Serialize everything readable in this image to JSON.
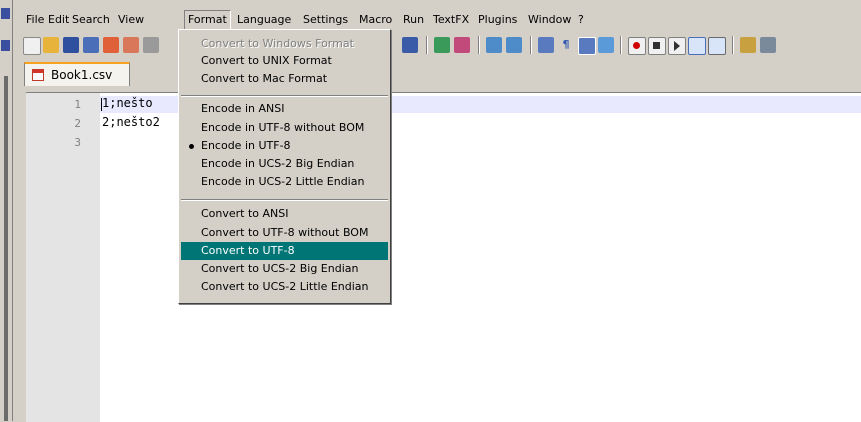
{
  "menubar": {
    "items": [
      "File",
      "Edit",
      "Search",
      "View",
      "Format",
      "Language",
      "Settings",
      "Macro",
      "Run",
      "TextFX",
      "Plugins",
      "Window",
      "?"
    ],
    "active": "Format"
  },
  "tab": {
    "label": "Book1.csv"
  },
  "editor": {
    "lines": [
      {
        "number": "1",
        "text": "1;nešto"
      },
      {
        "number": "2",
        "text": "2;nešto2"
      },
      {
        "number": "3",
        "text": ""
      }
    ]
  },
  "format_menu": {
    "items": [
      {
        "label": "Convert to Windows Format",
        "disabled": true
      },
      {
        "label": "Convert to UNIX Format"
      },
      {
        "label": "Convert to Mac Format"
      },
      {
        "label": "Encode in ANSI"
      },
      {
        "label": "Encode in UTF-8 without BOM"
      },
      {
        "label": "Encode in UTF-8",
        "checked": true
      },
      {
        "label": "Encode in UCS-2 Big Endian"
      },
      {
        "label": "Encode in UCS-2 Little Endian"
      },
      {
        "label": "Convert to ANSI"
      },
      {
        "label": "Convert to UTF-8 without BOM"
      },
      {
        "label": "Convert to UTF-8",
        "highlighted": true
      },
      {
        "label": "Convert to UCS-2 Big Endian"
      },
      {
        "label": "Convert to UCS-2 Little Endian"
      }
    ]
  },
  "colors": {
    "menu_highlight": "#007575",
    "current_line": "#e8e8ff",
    "tab_accent": "#f6a21c"
  }
}
